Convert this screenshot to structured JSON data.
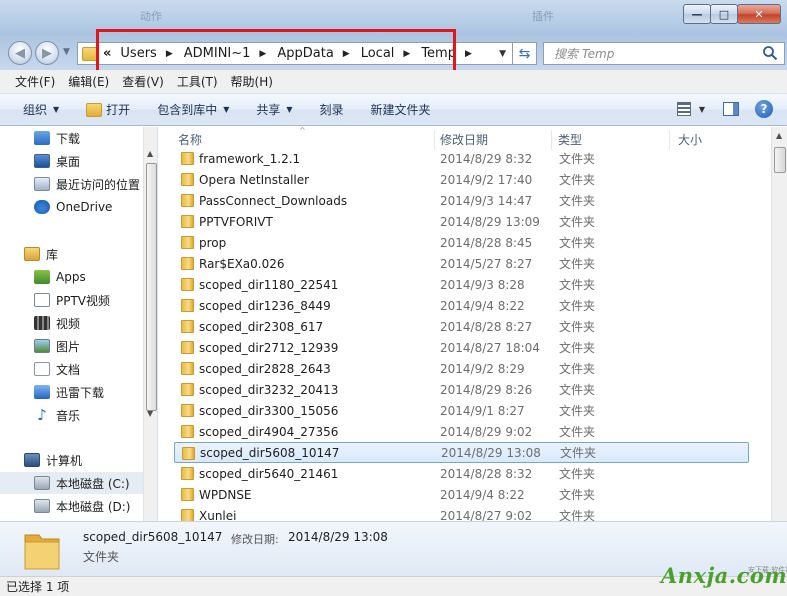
{
  "window": {
    "ghost_titles": [
      "动作",
      "插件"
    ],
    "controls": {
      "minimize": "—",
      "maximize": "□",
      "close": "✕"
    }
  },
  "address": {
    "lead": "«",
    "crumbs": [
      "Users",
      "ADMINI~1",
      "AppData",
      "Local",
      "Temp"
    ],
    "separator": "▶",
    "dropdown": "▼",
    "refresh": "⇆",
    "search_placeholder": "搜索 Temp"
  },
  "menu": [
    "文件(F)",
    "编辑(E)",
    "查看(V)",
    "工具(T)",
    "帮助(H)"
  ],
  "toolbar": {
    "organize": "组织",
    "open": "打开",
    "include_in_library": "包含到库中",
    "share": "共享",
    "burn": "刻录",
    "new_folder": "新建文件夹",
    "dropdown_arrow": "▼",
    "help": "?"
  },
  "nav": {
    "favorites": [
      {
        "label": "下载",
        "icon": "download-icon"
      },
      {
        "label": "桌面",
        "icon": "desktop-icon"
      },
      {
        "label": "最近访问的位置",
        "icon": "recent-places-icon"
      },
      {
        "label": "OneDrive",
        "icon": "onedrive-icon"
      }
    ],
    "libraries_label": "库",
    "libraries": [
      {
        "label": "Apps",
        "icon": "apps-icon"
      },
      {
        "label": "PPTV视频",
        "icon": "pptv-icon"
      },
      {
        "label": "视频",
        "icon": "video-icon"
      },
      {
        "label": "图片",
        "icon": "pictures-icon"
      },
      {
        "label": "文档",
        "icon": "documents-icon"
      },
      {
        "label": "迅雷下载",
        "icon": "xunlei-icon"
      },
      {
        "label": "音乐",
        "icon": "music-icon"
      }
    ],
    "computer_label": "计算机",
    "drives": [
      {
        "label": "本地磁盘 (C:)",
        "icon": "drive-c-icon"
      },
      {
        "label": "本地磁盘 (D:)",
        "icon": "drive-d-icon"
      }
    ],
    "scroll_up": "▲",
    "scroll_down": "▼"
  },
  "columns": {
    "name": "名称",
    "date": "修改日期",
    "type": "类型",
    "size": "大小",
    "sort_indicator": "^"
  },
  "files": [
    {
      "name": "framework_1.2.1",
      "date": "2014/8/29 8:32",
      "type": "文件夹"
    },
    {
      "name": "Opera NetInstaller",
      "date": "2014/9/2 17:40",
      "type": "文件夹"
    },
    {
      "name": "PassConnect_Downloads",
      "date": "2014/9/3 14:47",
      "type": "文件夹"
    },
    {
      "name": "PPTVFORIVT",
      "date": "2014/8/29 13:09",
      "type": "文件夹"
    },
    {
      "name": "prop",
      "date": "2014/8/28 8:45",
      "type": "文件夹"
    },
    {
      "name": "Rar$EXa0.026",
      "date": "2014/5/27 8:27",
      "type": "文件夹"
    },
    {
      "name": "scoped_dir1180_22541",
      "date": "2014/9/3 8:28",
      "type": "文件夹"
    },
    {
      "name": "scoped_dir1236_8449",
      "date": "2014/9/4 8:22",
      "type": "文件夹"
    },
    {
      "name": "scoped_dir2308_617",
      "date": "2014/8/28 8:27",
      "type": "文件夹"
    },
    {
      "name": "scoped_dir2712_12939",
      "date": "2014/8/27 18:04",
      "type": "文件夹"
    },
    {
      "name": "scoped_dir2828_2643",
      "date": "2014/9/2 8:29",
      "type": "文件夹"
    },
    {
      "name": "scoped_dir3232_20413",
      "date": "2014/8/29 8:26",
      "type": "文件夹"
    },
    {
      "name": "scoped_dir3300_15056",
      "date": "2014/9/1 8:27",
      "type": "文件夹"
    },
    {
      "name": "scoped_dir4904_27356",
      "date": "2014/8/29 9:02",
      "type": "文件夹"
    },
    {
      "name": "scoped_dir5608_10147",
      "date": "2014/8/29 13:08",
      "type": "文件夹",
      "selected": true
    },
    {
      "name": "scoped_dir5640_21461",
      "date": "2014/8/28 8:32",
      "type": "文件夹"
    },
    {
      "name": "WPDNSE",
      "date": "2014/9/4 8:22",
      "type": "文件夹"
    },
    {
      "name": "Xunlei",
      "date": "2014/8/27 9:02",
      "type": "文件夹"
    }
  ],
  "details": {
    "name": "scoped_dir5608_10147",
    "modified_label": "修改日期:",
    "modified": "2014/8/29 13:08",
    "type": "文件夹"
  },
  "status": {
    "text": "已选择 1 项"
  },
  "watermark": {
    "logo": "Anxja.com",
    "tagline": "安下载·软件站"
  },
  "colors": {
    "highlight": "#e0161c",
    "selection_border": "#7da2ce",
    "watermark": "#4aa02c"
  }
}
